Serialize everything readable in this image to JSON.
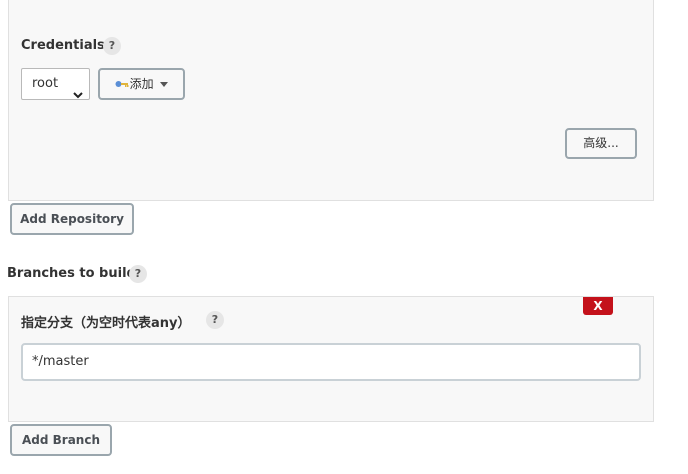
{
  "credentials": {
    "label": "Credentials",
    "help": "?",
    "selected": "root",
    "add_button": "添加",
    "advanced_button": "高级..."
  },
  "repository": {
    "add_button": "Add Repository"
  },
  "branches": {
    "label": "Branches to build",
    "help": "?",
    "specifier_label": "指定分支（为空时代表any）",
    "specifier_help": "?",
    "specifier_value": "*/master",
    "delete_button": "X",
    "add_button": "Add Branch"
  },
  "colors": {
    "delete": "#c4121b",
    "panel_bg": "#f8f8f8"
  }
}
